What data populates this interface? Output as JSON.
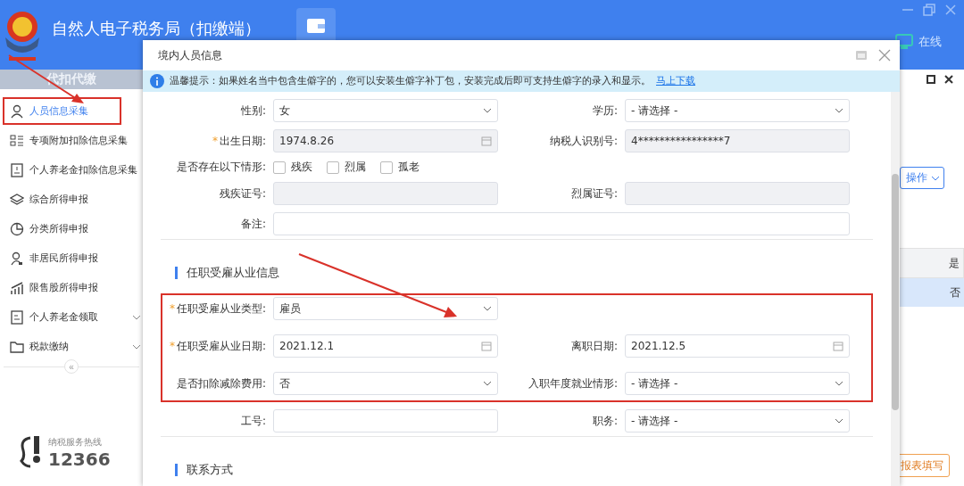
{
  "app": {
    "title": "自然人电子税务局（扣缴端）",
    "status": "在线"
  },
  "sidebar": {
    "section": "代扣代缴",
    "items": [
      {
        "label": "人员信息采集",
        "selected": true,
        "highlighted": true,
        "expandable": false
      },
      {
        "label": "专项附加扣除信息采集",
        "selected": false,
        "highlighted": false,
        "expandable": false
      },
      {
        "label": "个人养老金扣除信息采集",
        "selected": false,
        "highlighted": false,
        "expandable": false
      },
      {
        "label": "综合所得申报",
        "selected": false,
        "highlighted": false,
        "expandable": false
      },
      {
        "label": "分类所得申报",
        "selected": false,
        "highlighted": false,
        "expandable": false
      },
      {
        "label": "非居民所得申报",
        "selected": false,
        "highlighted": false,
        "expandable": false
      },
      {
        "label": "限售股所得申报",
        "selected": false,
        "highlighted": false,
        "expandable": false
      },
      {
        "label": "个人养老金领取",
        "selected": false,
        "highlighted": false,
        "expandable": true
      },
      {
        "label": "税款缴纳",
        "selected": false,
        "highlighted": false,
        "expandable": true
      }
    ],
    "collapse": "«",
    "hotline": {
      "label": "纳税服务热线",
      "number": "12366"
    }
  },
  "background": {
    "operate_button": "操作",
    "table": {
      "column": "是",
      "row": {
        "value": "否",
        "selected": true
      }
    },
    "report_button": "报表填写"
  },
  "dialog": {
    "title": "境内人员信息",
    "tip": {
      "text": "温馨提示：如果姓名当中包含生僻字的，您可以安装生僻字补丁包，安装完成后即可支持生僻字的录入和显示。",
      "link": "马上下载"
    },
    "sections": [
      {
        "groups": [
          {
            "highlighted": false,
            "rows": [
              [
                {
                  "label": "性别:",
                  "required": false,
                  "kind": "select",
                  "value": "女",
                  "disabled": false
                },
                {
                  "label": "学历:",
                  "required": false,
                  "kind": "select",
                  "value": "- 请选择 -",
                  "disabled": false
                }
              ],
              [
                {
                  "label": "出生日期:",
                  "required": true,
                  "kind": "date",
                  "value": "1974.8.26",
                  "disabled": true
                },
                {
                  "label": "纳税人识别号:",
                  "required": false,
                  "kind": "text",
                  "value": "4****************7",
                  "disabled": true
                }
              ],
              [
                {
                  "label": "是否存在以下情形:",
                  "required": false,
                  "kind": "checkboxes",
                  "options": [
                    {
                      "label": "残疾",
                      "checked": false
                    },
                    {
                      "label": "烈属",
                      "checked": false
                    },
                    {
                      "label": "孤老",
                      "checked": false
                    }
                  ]
                }
              ],
              [
                {
                  "label": "残疾证号:",
                  "required": false,
                  "kind": "text",
                  "disabled": true
                },
                {
                  "label": "烈属证号:",
                  "required": false,
                  "kind": "text",
                  "disabled": true
                }
              ],
              [
                {
                  "label": "备注:",
                  "required": false,
                  "kind": "wide",
                  "disabled": false
                }
              ]
            ]
          }
        ]
      },
      {
        "title": "任职受雇从业信息",
        "groups": [
          {
            "highlighted": true,
            "rows": [
              [
                {
                  "label": "任职受雇从业类型:",
                  "required": true,
                  "kind": "select",
                  "value": "雇员",
                  "disabled": false
                }
              ],
              [
                {
                  "label": "任职受雇从业日期:",
                  "required": true,
                  "kind": "date",
                  "value": "2021.12.1",
                  "disabled": false
                },
                {
                  "label": "离职日期:",
                  "required": false,
                  "kind": "date",
                  "value": "2021.12.5",
                  "disabled": false
                }
              ],
              [
                {
                  "label": "是否扣除减除费用:",
                  "required": false,
                  "kind": "select",
                  "value": "否",
                  "disabled": false
                },
                {
                  "label": "入职年度就业情形:",
                  "required": false,
                  "kind": "select",
                  "value": "- 请选择 -",
                  "disabled": false
                }
              ]
            ]
          },
          {
            "highlighted": false,
            "rows": [
              [
                {
                  "label": "工号:",
                  "required": false,
                  "kind": "text",
                  "disabled": false
                },
                {
                  "label": "职务:",
                  "required": false,
                  "kind": "select",
                  "value": "- 请选择 -",
                  "disabled": false
                }
              ]
            ]
          }
        ]
      },
      {
        "title": "联系方式"
      }
    ]
  },
  "required_mark": "*"
}
